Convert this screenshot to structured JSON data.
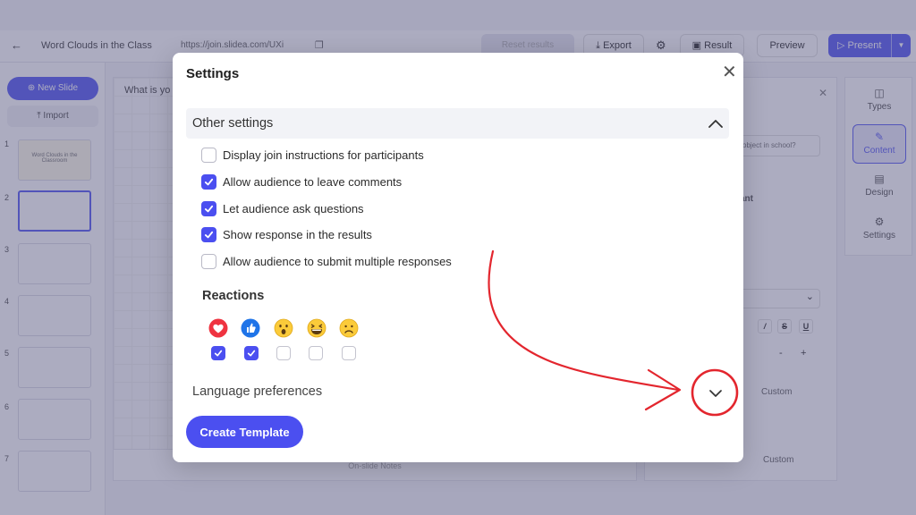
{
  "app": {
    "back_icon": "arrow-left-icon",
    "doc_title": "Word Clouds in the Class",
    "join_url": "https://join.slidea.com/UXi",
    "reset_label": "Reset results",
    "export_label": "Export",
    "result_label": "Result",
    "preview_label": "Preview",
    "present_label": "Present",
    "new_slide_label": "New Slide",
    "import_label": "Import",
    "slide_numbers": [
      "1",
      "2",
      "3",
      "4",
      "5",
      "6",
      "7"
    ],
    "slide1_title": "Word Clouds in the Classroom",
    "canvas_question": "What is yo",
    "notes_label": "On-slide Notes",
    "rp_input_text": "object in school?",
    "rp_participant_label": "ant",
    "rp_custom_label": "Custom",
    "tools": [
      {
        "label": "Types",
        "icon": "columns-icon"
      },
      {
        "label": "Content",
        "icon": "pencil-icon"
      },
      {
        "label": "Design",
        "icon": "brush-icon"
      },
      {
        "label": "Settings",
        "icon": "gear-icon"
      }
    ]
  },
  "modal": {
    "title": "Settings",
    "close_icon": "close-icon",
    "other_settings": {
      "title": "Other settings",
      "expanded": true,
      "options": [
        {
          "label": "Display join instructions for participants",
          "checked": false
        },
        {
          "label": "Allow audience to leave comments",
          "checked": true
        },
        {
          "label": "Let audience ask questions",
          "checked": true
        },
        {
          "label": "Show response in the results",
          "checked": true
        },
        {
          "label": "Allow audience to submit multiple responses",
          "checked": false
        }
      ]
    },
    "reactions": {
      "title": "Reactions",
      "items": [
        {
          "icon": "heart-icon",
          "checked": true
        },
        {
          "icon": "thumbs-up-icon",
          "checked": true
        },
        {
          "icon": "surprised-face-icon",
          "checked": false
        },
        {
          "icon": "laughing-face-icon",
          "checked": false
        },
        {
          "icon": "sad-face-icon",
          "checked": false
        }
      ]
    },
    "language": {
      "title": "Language preferences",
      "expanded": false
    },
    "create_template_label": "Create Template"
  },
  "colors": {
    "accent": "#4b4ff0",
    "annotation_red": "#e3262e",
    "section_bg": "#f2f3f7"
  }
}
